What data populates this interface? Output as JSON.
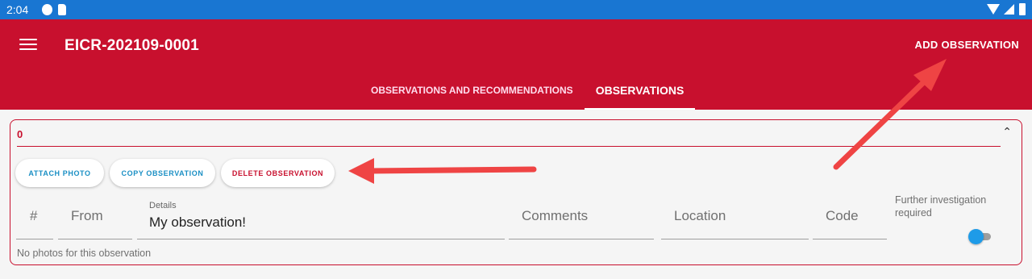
{
  "status_bar": {
    "time": "2:04",
    "icons": [
      "p-app-icon",
      "sd-card-icon",
      "wifi-icon",
      "signal-icon",
      "battery-icon"
    ]
  },
  "app_bar": {
    "title": "EICR-202109-0001",
    "action_label": "ADD OBSERVATION",
    "menu_icon": "hamburger-menu-icon",
    "color": "#c8102e"
  },
  "tabs": [
    {
      "label": "OBSERVATIONS AND RECOMMENDATIONS",
      "active": false
    },
    {
      "label": "OBSERVATIONS",
      "active": true
    }
  ],
  "observation": {
    "index": "0",
    "collapse_icon": "chevron-up-icon",
    "buttons": {
      "attach": "ATTACH PHOTO",
      "copy": "COPY OBSERVATION",
      "delete": "DELETE OBSERVATION"
    },
    "fields": {
      "number_placeholder": "#",
      "from_placeholder": "From",
      "details_label": "Details",
      "details_value": "My observation!",
      "comments_placeholder": "Comments",
      "location_placeholder": "Location",
      "code_placeholder": "Code"
    },
    "further_investigation_label": "Further investigation required",
    "further_investigation_on": true,
    "no_photos_text": "No photos for this observation"
  },
  "annotations": {
    "arrow_color": "#ef4444",
    "arrows": [
      "arrow-to-add-observation",
      "arrow-to-delete-observation"
    ]
  },
  "colors": {
    "status_bar": "#1976d2",
    "accent_blue": "#1a8fc4",
    "toggle_blue": "#1e9be8"
  }
}
